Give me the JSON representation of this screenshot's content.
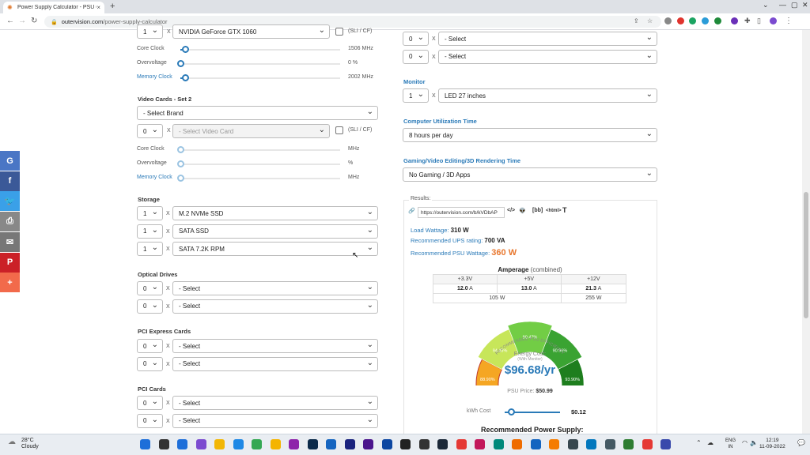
{
  "browser": {
    "tab_title": "Power Supply Calculator - PSU C",
    "tab_close": "×",
    "new_tab": "+",
    "url_domain": "outervision.com",
    "url_path": "/power-supply-calculator"
  },
  "share": {
    "items": [
      {
        "name": "google",
        "glyph": "G",
        "color": "#4a76c5"
      },
      {
        "name": "facebook",
        "glyph": "f",
        "color": "#3b5998"
      },
      {
        "name": "twitter",
        "glyph": "🐦",
        "color": "#3aa0e8"
      },
      {
        "name": "print",
        "glyph": "⎙",
        "color": "#888888"
      },
      {
        "name": "email",
        "glyph": "✉",
        "color": "#777777"
      },
      {
        "name": "pinterest",
        "glyph": "P",
        "color": "#cb2027"
      },
      {
        "name": "more",
        "glyph": "+",
        "color": "#f26a4b"
      }
    ]
  },
  "left": {
    "gpu1": {
      "qty": "1",
      "x": "X",
      "model": "NVIDIA GeForce GTX 1060",
      "sli": "(SLI / CF)"
    },
    "gpu1_sliders": [
      {
        "label": "Core Clock",
        "value": "1506 MHz",
        "level": 0.03
      },
      {
        "label": "Overvoltage",
        "value": "0 %",
        "level": 0.0
      },
      {
        "label": "Memory Clock",
        "value": "2002 MHz",
        "level": 0.03
      }
    ],
    "vc2_title": "Video Cards - Set 2",
    "vc2_brand": "- Select Brand",
    "vc2_qty": "0",
    "vc2_x": "X",
    "vc2_card": "- Select Video Card",
    "vc2_sli": "(SLI / CF)",
    "vc2_sliders": [
      {
        "label": "Core Clock",
        "value": "MHz"
      },
      {
        "label": "Overvoltage",
        "value": "%"
      },
      {
        "label": "Memory Clock",
        "value": "MHz"
      }
    ],
    "storage_title": "Storage",
    "storage": [
      {
        "qty": "1",
        "x": "X",
        "item": "M.2 NVMe SSD"
      },
      {
        "qty": "1",
        "x": "X",
        "item": "SATA SSD"
      },
      {
        "qty": "1",
        "x": "X",
        "item": "SATA 7.2K RPM"
      }
    ],
    "optical_title": "Optical Drives",
    "optical": [
      {
        "qty": "0",
        "x": "X",
        "item": "- Select"
      },
      {
        "qty": "0",
        "x": "X",
        "item": "- Select"
      }
    ],
    "pcie_title": "PCI Express Cards",
    "pcie": [
      {
        "qty": "0",
        "x": "X",
        "item": "- Select"
      },
      {
        "qty": "0",
        "x": "X",
        "item": "- Select"
      }
    ],
    "pci_title": "PCI Cards",
    "pci": [
      {
        "qty": "0",
        "x": "X",
        "item": "- Select"
      },
      {
        "qty": "0",
        "x": "X",
        "item": "- Select"
      }
    ]
  },
  "right": {
    "top_selects": [
      {
        "qty": "0",
        "x": "X",
        "item": "- Select"
      },
      {
        "qty": "0",
        "x": "X",
        "item": "- Select"
      }
    ],
    "monitor_title": "Monitor",
    "monitor": {
      "qty": "1",
      "x": "X",
      "item": "LED 27 inches"
    },
    "util_title": "Computer Utilization Time",
    "util_value": "8 hours per day",
    "gaming_title": "Gaming/Video Editing/3D Rendering Time",
    "gaming_value": "No Gaming / 3D Apps",
    "results_label": "Results:",
    "results_url": "https://outervision.com/b/kVDbAP",
    "share_icons": {
      "code": "</>",
      "bb": "[bb]",
      "html": "<html>",
      "text": "T"
    },
    "load_label": "Load Wattage:",
    "load_value": "310 W",
    "ups_label": "Recommended UPS rating:",
    "ups_value": "700 VA",
    "psu_label": "Recommended PSU Wattage:",
    "psu_value": "360 W",
    "amp_title": "Amperage",
    "amp_sub": "(combined)",
    "amp_headers": [
      "+3.3V",
      "+5V",
      "+12V"
    ],
    "amp_values": [
      "12.0",
      "13.0",
      "21.3"
    ],
    "amp_unit": "A",
    "amp_watts_a": "105 W",
    "amp_watts_b": "255 W",
    "gauge_title": "RECOMMENDED PSU EFFICIENCY",
    "gauge_segments": [
      {
        "label": "88.90%",
        "color": "#f5a623"
      },
      {
        "label": "94.43%",
        "color": "#c7e65a"
      },
      {
        "label": "90.47%",
        "color": "#72cd45"
      },
      {
        "label": "90.96%",
        "color": "#3aa332"
      },
      {
        "label": "93.90%",
        "color": "#1e7e1e"
      }
    ],
    "energy_label": "Energy Cost:",
    "energy_sub": "(With Monitor)",
    "energy_value": "$96.68/yr",
    "psu_price_label": "PSU Price:",
    "psu_price_value": "$50.99",
    "kwh_label": "kWh Cost",
    "kwh_value": "$0.12",
    "kwh_level": 0.12,
    "recommended_title": "Recommended Power Supply:"
  },
  "taskbar": {
    "temp": "28°C",
    "weather": "Cloudy",
    "lang1": "ENG",
    "lang2": "IN",
    "time": "12:19",
    "date": "11-09-2022"
  }
}
